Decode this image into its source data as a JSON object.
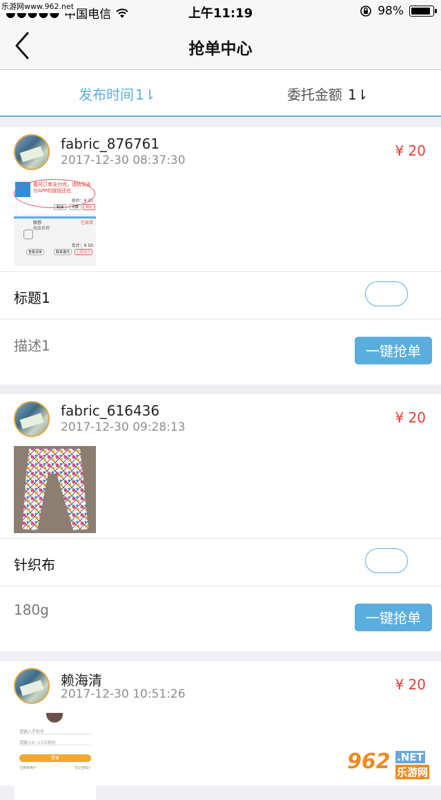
{
  "status_bar": {
    "carrier": "中国电信",
    "time": "上午11:19",
    "battery": "98%",
    "battery_level": 0.98
  },
  "watermark": {
    "top_left": "乐游网www.962.net",
    "logo_number": "962",
    "logo_suffix": ".NET",
    "logo_text": "乐游网"
  },
  "nav": {
    "title": "抢单中心"
  },
  "sort_tabs": [
    {
      "label": "发布时间",
      "arrow": "1⇂"
    },
    {
      "label": "委托金额",
      "arrow": "1⇂"
    }
  ],
  "orders": [
    {
      "username": "fabric_876761",
      "date": "2017-12-30 08:37:30",
      "price": "¥ 20",
      "title": "标题1",
      "description": "描述1",
      "action": "一键抢单",
      "thumb": {
        "note": "委托订单支付完，请转到支付APP的按钮还在",
        "fee": "总价：¥ 20",
        "btn1": "取消",
        "btn2": "付款",
        "btn3": "确定",
        "status": "已接单",
        "fee2": "合计：¥ 50",
        "btn4": "查看清单",
        "btn5": "联系委托",
        "btn6": "立即支付",
        "sub": "联想",
        "sub2": "商品名称"
      }
    },
    {
      "username": "fabric_616436",
      "date": "2017-12-30 09:28:13",
      "price": "¥ 20",
      "title": "针织布",
      "description": "180g",
      "action": "一键抢单"
    },
    {
      "username": "赖海清",
      "date": "2017-12-30 10:51:26",
      "price": "¥ 20",
      "thumb": {
        "line1": "请输入手机号",
        "line2": "请输入6~11位密码",
        "btn": "登录",
        "link1": "注册新用户",
        "link2": "忘记密码?"
      }
    }
  ]
}
